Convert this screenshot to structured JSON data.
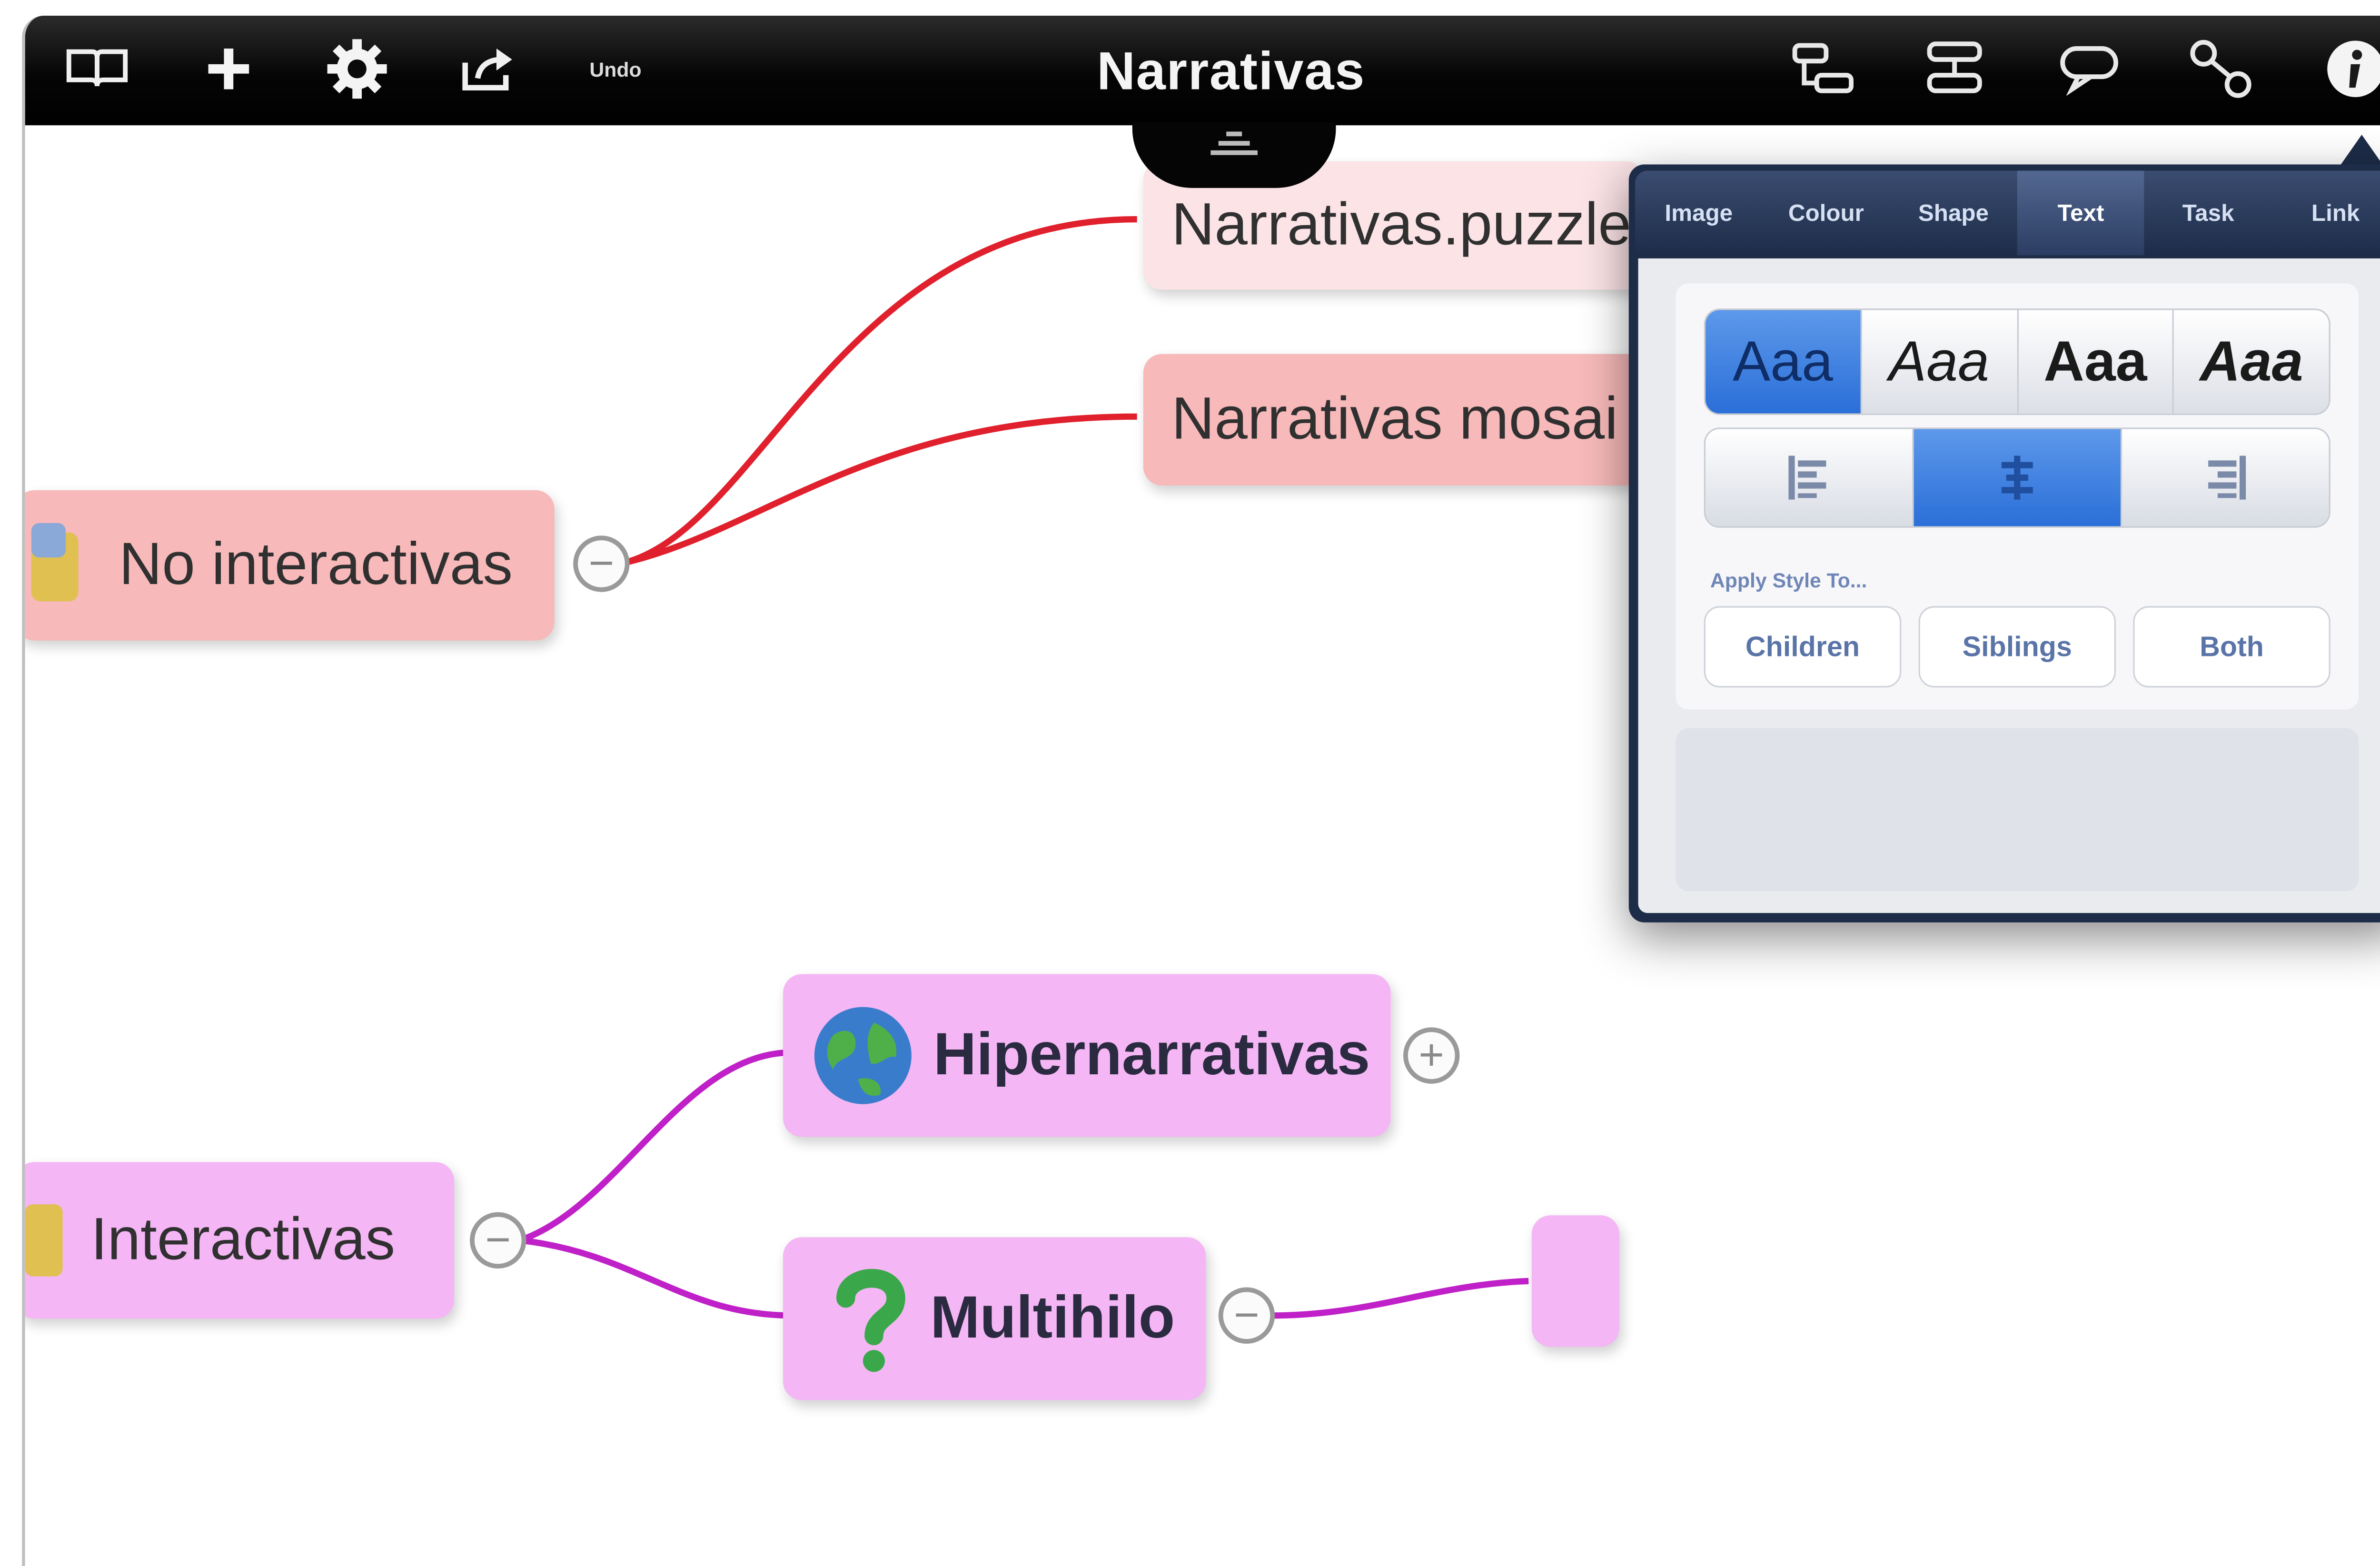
{
  "toolbar": {
    "title": "Narrativas",
    "undo_label": "Undo",
    "left_icons": [
      "book-icon",
      "add-icon",
      "gear-icon",
      "share-icon"
    ],
    "right_icons": [
      "tree-layout-icon",
      "list-layout-icon",
      "comment-icon",
      "link-icon",
      "info-icon"
    ]
  },
  "map": {
    "nodes": {
      "no_interactivas": "No interactivas",
      "puzzle": "Narrativas.puzzle",
      "mosaic": "Narrativas mosai",
      "interactivas": "Interactivas",
      "hipernarrativas": "Hipernarrativas",
      "multihilo": "Multihilo"
    },
    "colors": {
      "red_branch": "#e0202c",
      "pink_branch": "#c020c8",
      "red_node": "#f7b9b9",
      "pink_node": "#f4b6f4"
    }
  },
  "inspector": {
    "tabs": [
      "Image",
      "Colour",
      "Shape",
      "Text",
      "Task",
      "Link"
    ],
    "active_tab": "Text",
    "font_styles": [
      "Aaa",
      "Aaa",
      "Aaa",
      "Aaa"
    ],
    "selected_font": 0,
    "alignment_selected": "center",
    "apply_label": "Apply Style To...",
    "apply_buttons": [
      "Children",
      "Siblings",
      "Both"
    ]
  }
}
